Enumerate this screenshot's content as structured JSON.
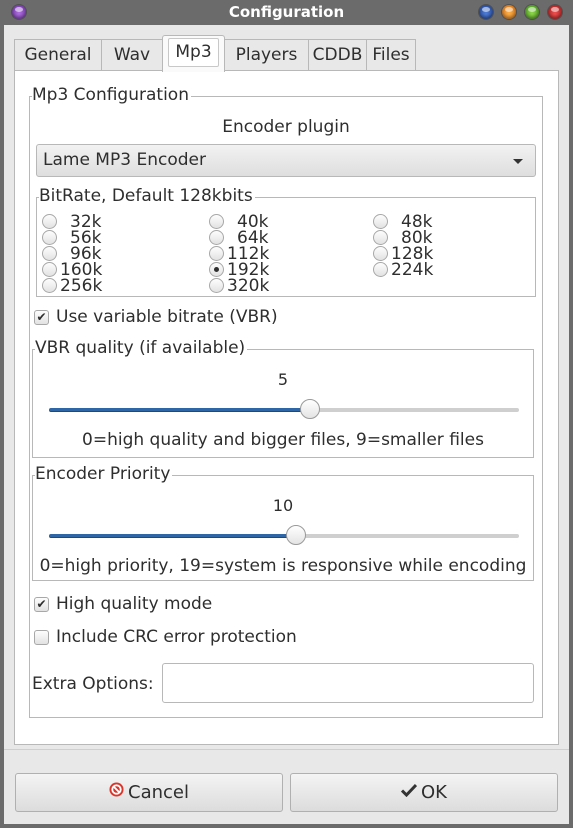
{
  "window": {
    "title": "Configuration",
    "controls": [
      "menu-orb",
      "minimize-orb",
      "shade-orb",
      "maximize-orb",
      "close-orb"
    ]
  },
  "tabs": [
    {
      "label": "General",
      "active": false
    },
    {
      "label": "Wav",
      "active": false
    },
    {
      "label": "Mp3",
      "active": true
    },
    {
      "label": "Players",
      "active": false
    },
    {
      "label": "CDDB",
      "active": false
    },
    {
      "label": "Files",
      "active": false
    }
  ],
  "mp3": {
    "group_title": "Mp3 Configuration",
    "encoder_plugin_label": "Encoder plugin",
    "encoder_plugin_value": "Lame MP3 Encoder",
    "bitrate": {
      "title": "BitRate, Default 128kbits",
      "selected": "192k",
      "columns": [
        [
          "32k",
          "56k",
          "96k",
          "160k",
          "256k"
        ],
        [
          "40k",
          "64k",
          "112k",
          "192k",
          "320k"
        ],
        [
          "48k",
          "80k",
          "128k",
          "224k"
        ]
      ]
    },
    "vbr_checkbox": {
      "label": "Use variable bitrate (VBR)",
      "checked": true
    },
    "vbr_quality": {
      "title": "VBR quality (if available)",
      "value": 5,
      "min": 0,
      "max": 9,
      "value_label": "5",
      "description": "0=high quality and bigger files, 9=smaller files"
    },
    "encoder_priority": {
      "title": "Encoder Priority",
      "value": 10,
      "min": 0,
      "max": 19,
      "value_label": "10",
      "description": "0=high priority, 19=system is responsive while encoding"
    },
    "high_quality_checkbox": {
      "label": "High quality mode",
      "checked": true
    },
    "crc_checkbox": {
      "label": "Include CRC error protection",
      "checked": false
    },
    "extra_options": {
      "label": "Extra Options:",
      "value": ""
    }
  },
  "buttons": {
    "cancel": "Cancel",
    "ok": "OK"
  },
  "colors": {
    "accent": "#2f66a6",
    "titlebar": "#6b6b6b",
    "cancel_icon": "#d9352b"
  }
}
